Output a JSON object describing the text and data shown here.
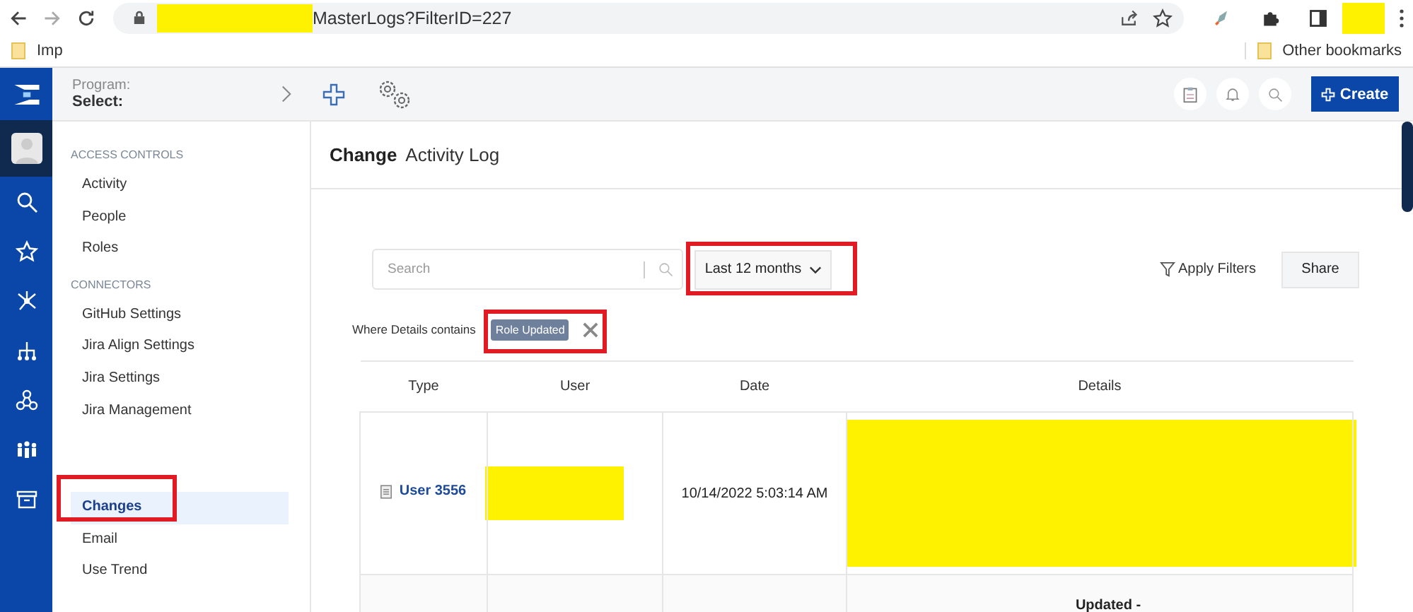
{
  "browser": {
    "url": "MasterLogs?FilterID=227",
    "bookmarks": [
      "Imp"
    ],
    "other_bookmarks": "Other bookmarks"
  },
  "header": {
    "program_label": "Program:",
    "program_value": "Select:",
    "create_button": "Create"
  },
  "sidebar": {
    "sections": [
      {
        "title": "ACCESS CONTROLS",
        "items": [
          {
            "label": "Activity",
            "selected": false
          },
          {
            "label": "People",
            "selected": false
          },
          {
            "label": "Roles",
            "selected": false
          }
        ]
      },
      {
        "title": "CONNECTORS",
        "items": [
          {
            "label": "GitHub Settings",
            "selected": false
          },
          {
            "label": "Jira Align Settings",
            "selected": false
          },
          {
            "label": "Jira Settings",
            "selected": false
          },
          {
            "label": "Jira Management",
            "selected": false
          }
        ]
      },
      {
        "items": [
          {
            "label": "Changes",
            "selected": true
          },
          {
            "label": "Email",
            "selected": false
          },
          {
            "label": "Use Trend",
            "selected": false
          }
        ]
      }
    ]
  },
  "page": {
    "title_bold": "Change",
    "title": "Activity Log"
  },
  "filters": {
    "search": {
      "placeholder": "Search"
    },
    "range": "Last 12 months",
    "apply": "Apply Filters",
    "share": "Share",
    "condition_label": "Where Details contains",
    "tag": "Role Updated"
  },
  "table": {
    "columns": [
      "Type",
      "User",
      "Date",
      "Details"
    ],
    "rows": [
      {
        "type": "User 3556",
        "date": "10/14/2022 5:03:14 AM"
      },
      {
        "details": "Updated -"
      }
    ]
  }
}
